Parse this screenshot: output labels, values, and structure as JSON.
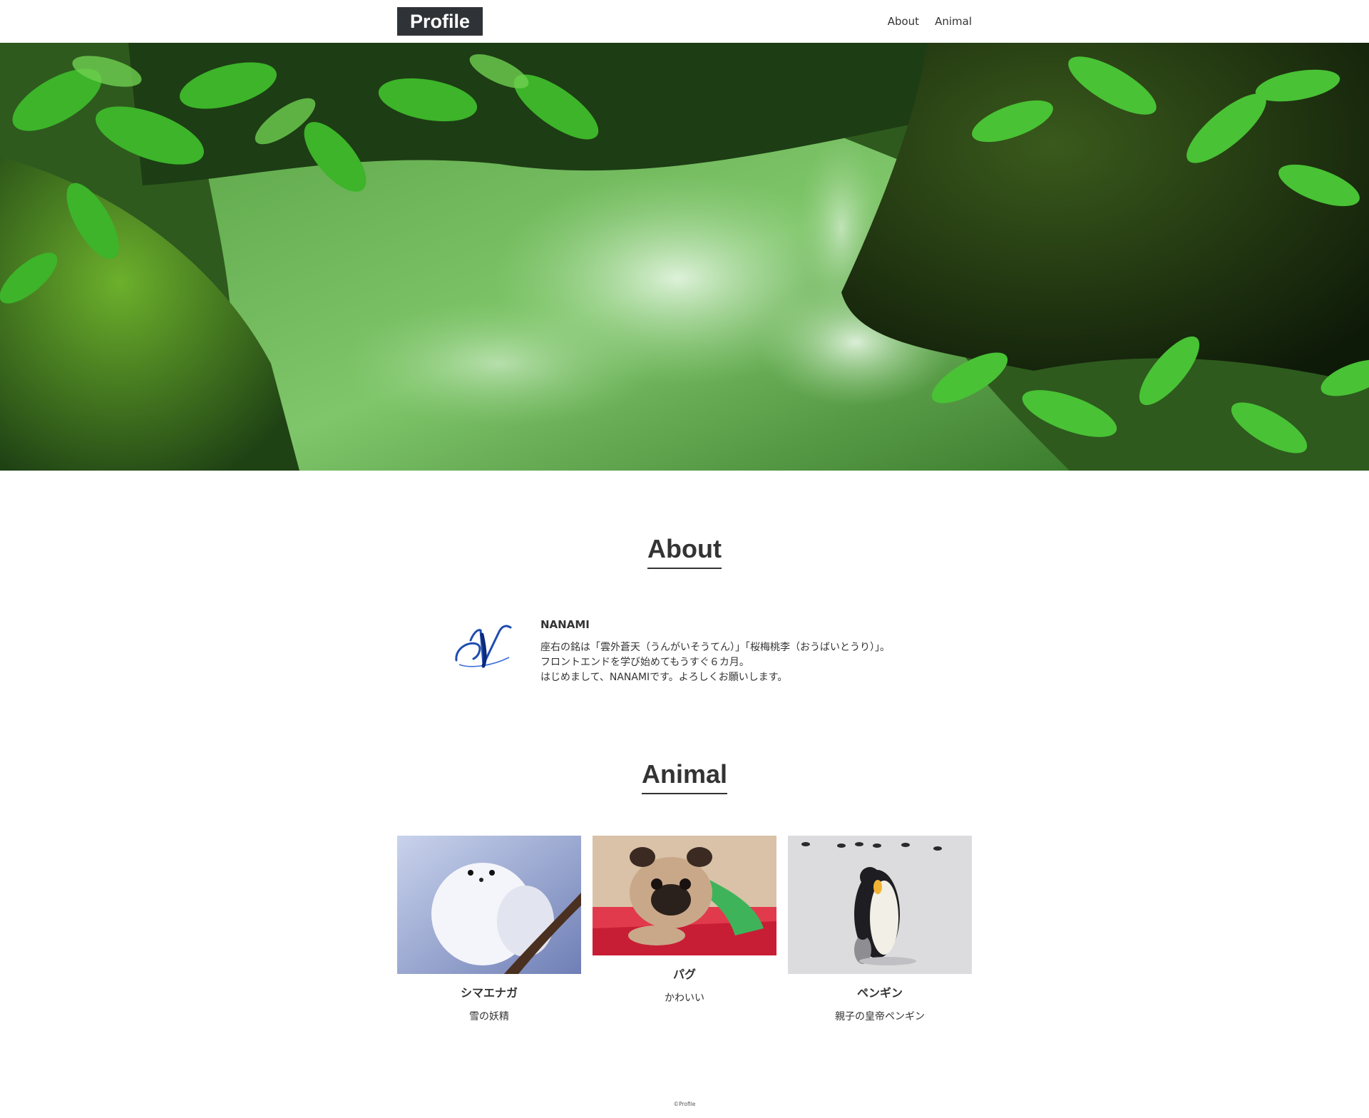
{
  "header": {
    "logo": "Profile",
    "nav": [
      "About",
      "Animal"
    ]
  },
  "hero": {
    "image": "forest-stream-photo"
  },
  "about": {
    "title": "About",
    "icon": "script-letter-n-logo",
    "name": "NANAMI",
    "lines": [
      "座右の銘は「雲外蒼天（うんがいそうてん）」「桜梅桃李（おうばいとうり）」。",
      "フロントエンドを学び始めてもうすぐ６カ月。",
      "はじめまして、NANAMIです。よろしくお願いします。"
    ]
  },
  "animal": {
    "title": "Animal",
    "cards": [
      {
        "image": "long-tailed-tit-photo",
        "name": "シマエナガ",
        "desc": "雪の妖精"
      },
      {
        "image": "pug-puppy-photo",
        "name": "パグ",
        "desc": "かわいい"
      },
      {
        "image": "emperor-penguin-photo",
        "name": "ペンギン",
        "desc": "親子の皇帝ペンギン"
      }
    ]
  },
  "footer": {
    "copyright": "©Profile"
  },
  "colors": {
    "logo_bg": "#2f3337",
    "text": "#333333",
    "hero_green": "#3f9a2e"
  }
}
